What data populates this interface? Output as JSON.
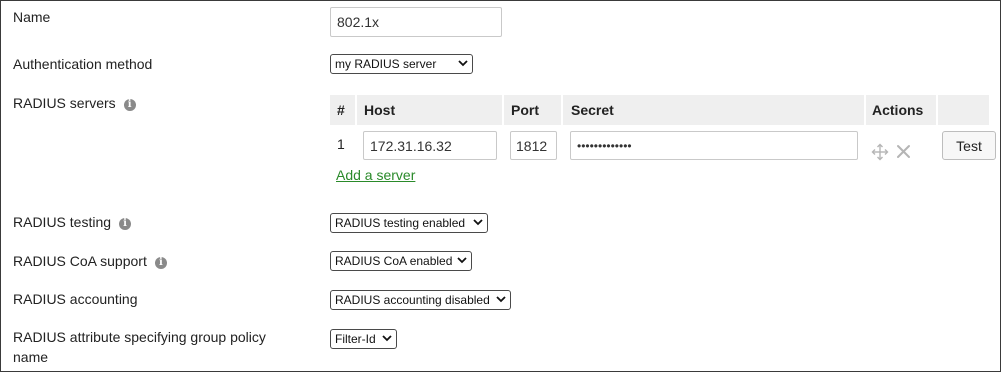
{
  "fields": {
    "name_label": "Name",
    "name_value": "802.1x",
    "auth_label": "Authentication method",
    "auth_value": "my RADIUS server",
    "radius_servers_label": "RADIUS servers",
    "radius_testing_label": "RADIUS testing",
    "radius_testing_value": "RADIUS testing enabled",
    "coa_label": "RADIUS CoA support",
    "coa_value": "RADIUS CoA enabled",
    "accounting_label": "RADIUS accounting",
    "accounting_value": "RADIUS accounting disabled",
    "group_policy_label_line1": "RADIUS attribute specifying group policy",
    "group_policy_label_line2": "name",
    "group_policy_value": "Filter-Id"
  },
  "servers_table": {
    "headers": {
      "num": "#",
      "host": "Host",
      "port": "Port",
      "secret": "Secret",
      "actions": "Actions"
    },
    "rows": [
      {
        "num": "1",
        "host": "172.31.16.32",
        "port": "1812",
        "secret": "•••••••••••••"
      }
    ],
    "add_link": "Add a server",
    "test_button": "Test"
  },
  "icons": {
    "info": "info-icon",
    "move": "move-icon",
    "delete": "close-icon",
    "dropdown": "chevron-down-icon"
  },
  "colors": {
    "link": "#2a8a2a",
    "header_bg": "#efefef",
    "icon_gray": "#b5b5b5"
  }
}
